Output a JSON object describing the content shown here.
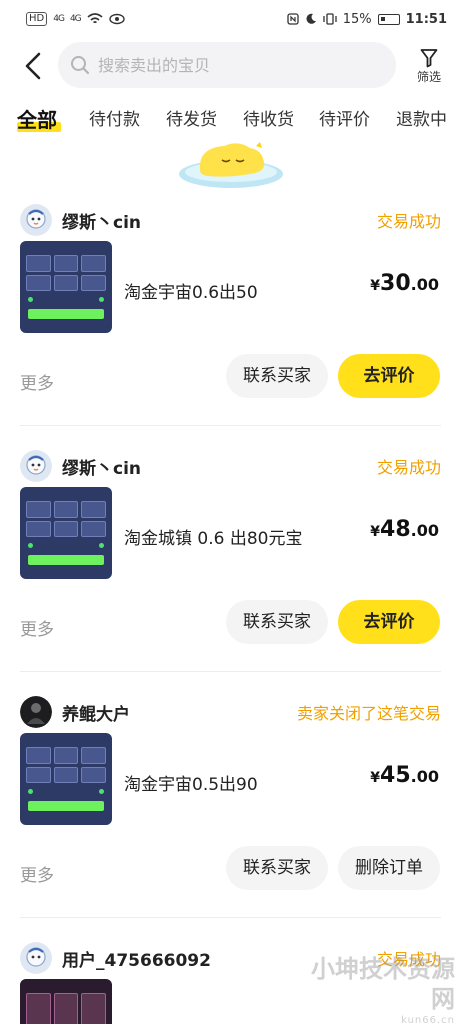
{
  "status_bar": {
    "sim_chip": "HD",
    "network_4g_1": "4G",
    "network_4g_2": "4G",
    "battery_pct": "15%",
    "time": "11:51"
  },
  "search": {
    "placeholder": "搜索卖出的宝贝"
  },
  "filter": {
    "label": "筛选"
  },
  "tabs": [
    {
      "label": "全部",
      "active": true
    },
    {
      "label": "待付款"
    },
    {
      "label": "待发货"
    },
    {
      "label": "待收货"
    },
    {
      "label": "待评价"
    },
    {
      "label": "退款中"
    }
  ],
  "orders": [
    {
      "buyer": "缪斯丶cin",
      "status": "交易成功",
      "title": "淘金宇宙0.6出50",
      "price_currency": "¥",
      "price_int": "30",
      "price_dec": ".00",
      "more": "更多",
      "action_secondary": "联系买家",
      "action_primary": "去评价"
    },
    {
      "buyer": "缪斯丶cin",
      "status": "交易成功",
      "title": "淘金城镇 0.6 出80元宝",
      "price_currency": "¥",
      "price_int": "48",
      "price_dec": ".00",
      "more": "更多",
      "action_secondary": "联系买家",
      "action_primary": "去评价"
    },
    {
      "buyer": "养鲲大户",
      "status": "卖家关闭了这笔交易",
      "title": "淘金宇宙0.5出90",
      "price_currency": "¥",
      "price_int": "45",
      "price_dec": ".00",
      "more": "更多",
      "action_secondary": "联系买家",
      "action_secondary_2": "删除订单"
    },
    {
      "buyer": "用户_475666092",
      "status": "交易成功"
    }
  ],
  "watermark": {
    "text": "小坤技术资源网",
    "site": "kun66.cn"
  },
  "colors": {
    "accent_yellow": "#ffe01a",
    "status_orange": "#f0a000",
    "muted_gray": "#999999"
  }
}
